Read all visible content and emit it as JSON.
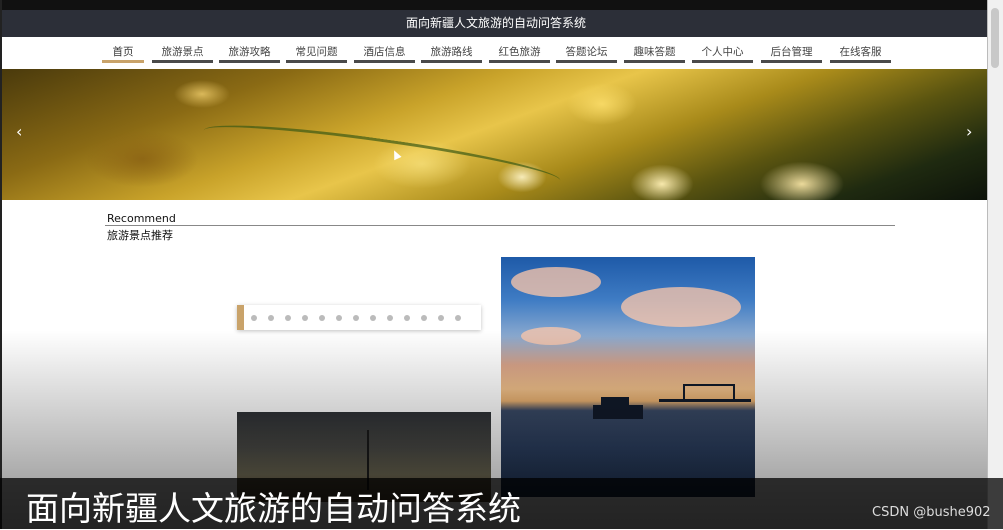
{
  "app": {
    "title": "面向新疆人文旅游的自动问答系统"
  },
  "nav": {
    "items": [
      {
        "label": "首页",
        "active": true
      },
      {
        "label": "旅游景点"
      },
      {
        "label": "旅游攻略"
      },
      {
        "label": "常见问题"
      },
      {
        "label": "酒店信息"
      },
      {
        "label": "旅游路线"
      },
      {
        "label": "红色旅游"
      },
      {
        "label": "答题论坛"
      },
      {
        "label": "趣味答题"
      },
      {
        "label": "个人中心"
      },
      {
        "label": "后台管理"
      },
      {
        "label": "在线客服"
      }
    ]
  },
  "banner": {
    "prev": "‹",
    "next": "›"
  },
  "recommend": {
    "en": "Recommend",
    "cn": "旅游景点推荐"
  },
  "carousel": {
    "dot_count": 13
  },
  "overlay": {
    "subtitle": "面向新疆人文旅游的自动问答系统",
    "watermark": "CSDN @bushe902"
  },
  "colors": {
    "accent": "#c9a36a",
    "titlebar": "#2c2f38"
  }
}
